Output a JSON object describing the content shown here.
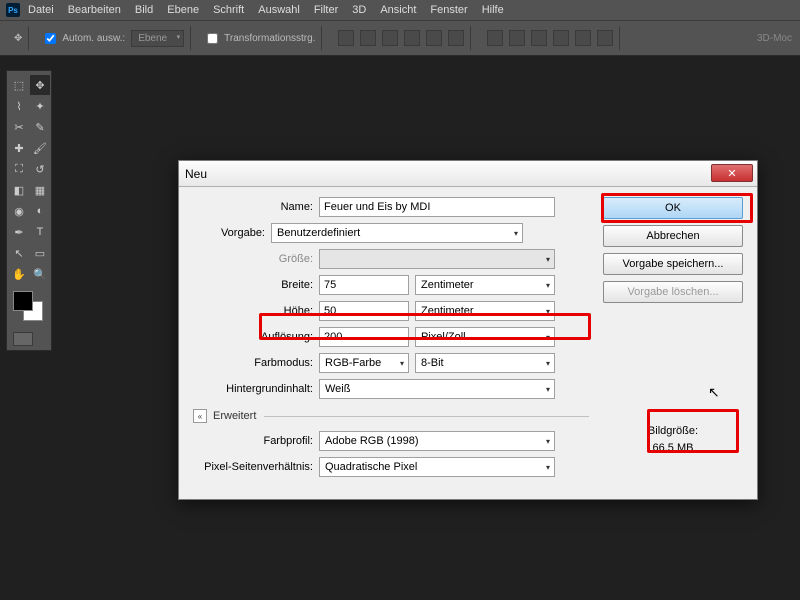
{
  "menus": [
    "Datei",
    "Bearbeiten",
    "Bild",
    "Ebene",
    "Schrift",
    "Auswahl",
    "Filter",
    "3D",
    "Ansicht",
    "Fenster",
    "Hilfe"
  ],
  "opts": {
    "auto": "Autom. ausw.:",
    "layer": "Ebene",
    "transform": "Transformationsstrg.",
    "mode3d": "3D-Moc"
  },
  "dialog": {
    "title": "Neu",
    "name_lbl": "Name:",
    "name_val": "Feuer und Eis by MDI",
    "preset_lbl": "Vorgabe:",
    "preset_val": "Benutzerdefiniert",
    "size_lbl": "Größe:",
    "width_lbl": "Breite:",
    "width_val": "75",
    "width_unit": "Zentimeter",
    "height_lbl": "Höhe:",
    "height_val": "50",
    "height_unit": "Zentimeter",
    "res_lbl": "Auflösung:",
    "res_val": "200",
    "res_unit": "Pixel/Zoll",
    "mode_lbl": "Farbmodus:",
    "mode_val": "RGB-Farbe",
    "bit_val": "8-Bit",
    "bg_lbl": "Hintergrundinhalt:",
    "bg_val": "Weiß",
    "adv": "Erweitert",
    "profile_lbl": "Farbprofil:",
    "profile_val": "Adobe RGB (1998)",
    "aspect_lbl": "Pixel-Seitenverhältnis:",
    "aspect_val": "Quadratische Pixel",
    "ok": "OK",
    "cancel": "Abbrechen",
    "save_preset": "Vorgabe speichern...",
    "del_preset": "Vorgabe löschen...",
    "imgsize_lbl": "Bildgröße:",
    "imgsize_val": "66,5 MB"
  }
}
